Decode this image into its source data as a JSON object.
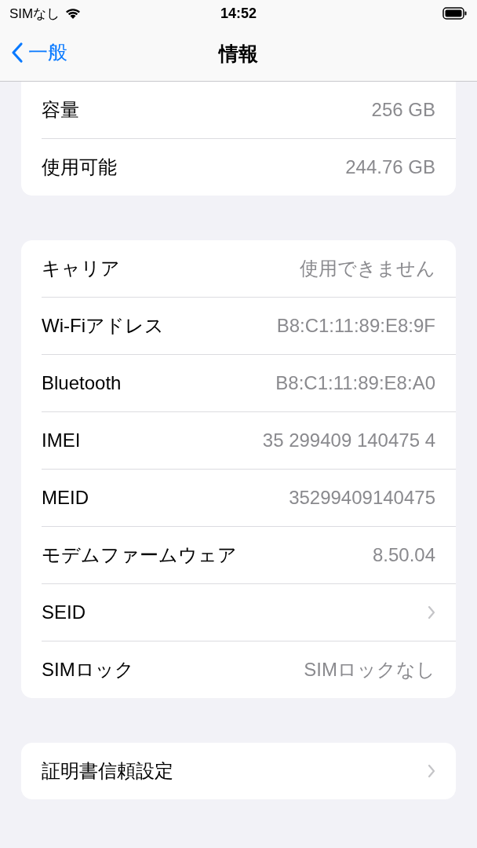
{
  "status_bar": {
    "carrier": "SIMなし",
    "time": "14:52"
  },
  "nav": {
    "back": "一般",
    "title": "情報"
  },
  "groups": [
    {
      "cut_top": true,
      "rows": [
        {
          "kind": "value",
          "label": "容量",
          "value": "256 GB"
        },
        {
          "kind": "value",
          "label": "使用可能",
          "value": "244.76 GB"
        }
      ]
    },
    {
      "cut_top": false,
      "rows": [
        {
          "kind": "value",
          "label": "キャリア",
          "value": "使用できません"
        },
        {
          "kind": "value",
          "label": "Wi-Fiアドレス",
          "value": "B8:C1:11:89:E8:9F"
        },
        {
          "kind": "value",
          "label": "Bluetooth",
          "value": "B8:C1:11:89:E8:A0"
        },
        {
          "kind": "value",
          "label": "IMEI",
          "value": "35 299409 140475 4"
        },
        {
          "kind": "value",
          "label": "MEID",
          "value": "35299409140475"
        },
        {
          "kind": "value",
          "label": "モデムファームウェア",
          "value": "8.50.04"
        },
        {
          "kind": "link",
          "label": "SEID"
        },
        {
          "kind": "value",
          "label": "SIMロック",
          "value": "SIMロックなし"
        }
      ]
    },
    {
      "cut_top": false,
      "rows": [
        {
          "kind": "link",
          "label": "証明書信頼設定"
        }
      ]
    }
  ]
}
